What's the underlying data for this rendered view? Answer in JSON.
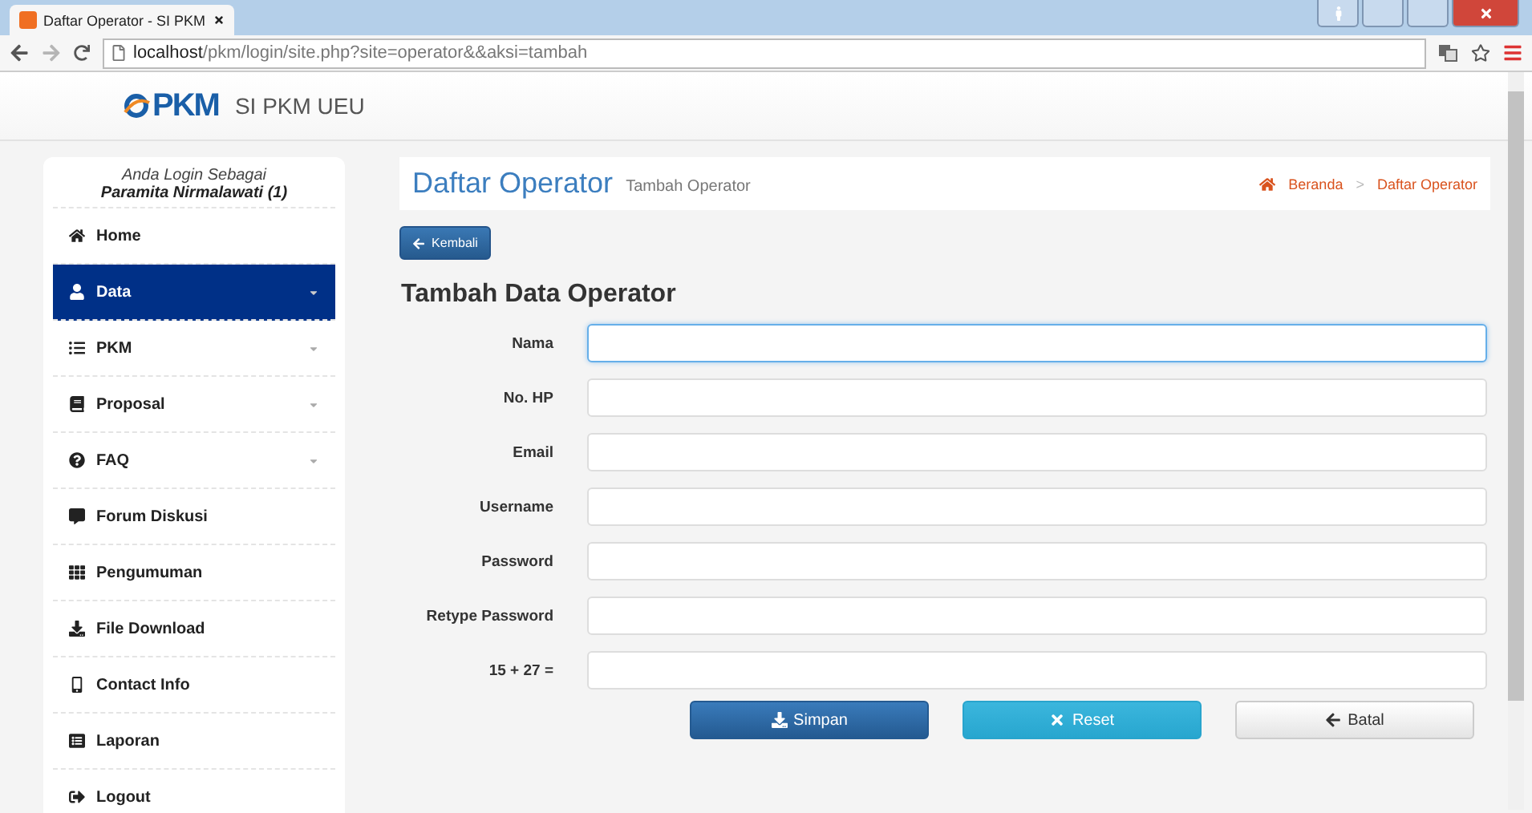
{
  "browser": {
    "tab_title": "Daftar Operator - SI PKM",
    "url_host": "localhost",
    "url_path": "/pkm/login/site.php?site=operator&&aksi=tambah"
  },
  "header": {
    "logo": "PKM",
    "app_name": "SI PKM UEU"
  },
  "sidebar": {
    "login_label": "Anda Login Sebagai",
    "user": "Paramita Nirmalawati (1)",
    "items": [
      {
        "label": "Home",
        "kind": "link",
        "selected": false
      },
      {
        "label": "Data",
        "kind": "menu",
        "selected": true
      },
      {
        "label": "PKM",
        "kind": "menu",
        "selected": false
      },
      {
        "label": "Proposal",
        "kind": "menu",
        "selected": false
      },
      {
        "label": "FAQ",
        "kind": "menu",
        "selected": false
      },
      {
        "label": "Forum Diskusi",
        "kind": "link",
        "selected": false
      },
      {
        "label": "Pengumuman",
        "kind": "link",
        "selected": false
      },
      {
        "label": "File Download",
        "kind": "link",
        "selected": false
      },
      {
        "label": "Contact Info",
        "kind": "link",
        "selected": false
      },
      {
        "label": "Laporan",
        "kind": "link",
        "selected": false
      },
      {
        "label": "Logout",
        "kind": "link",
        "selected": false
      }
    ]
  },
  "page_header": {
    "title": "Daftar Operator",
    "subtitle": "Tambah Operator",
    "breadcrumb": [
      "Beranda",
      "Daftar Operator"
    ],
    "breadcrumb_separator": ">"
  },
  "back_button": "Kembali",
  "form": {
    "title": "Tambah Data Operator",
    "fields": [
      {
        "label": "Nama",
        "focused": true
      },
      {
        "label": "No. HP",
        "focused": false
      },
      {
        "label": "Email",
        "focused": false
      },
      {
        "label": "Username",
        "focused": false
      },
      {
        "label": "Password",
        "focused": false
      },
      {
        "label": "Retype Password",
        "focused": false
      },
      {
        "label": "15 + 27 =",
        "focused": false
      }
    ],
    "buttons": [
      {
        "label": "Simpan",
        "kind": "primary"
      },
      {
        "label": "Reset",
        "kind": "info"
      },
      {
        "label": "Batal",
        "kind": "default"
      }
    ]
  }
}
